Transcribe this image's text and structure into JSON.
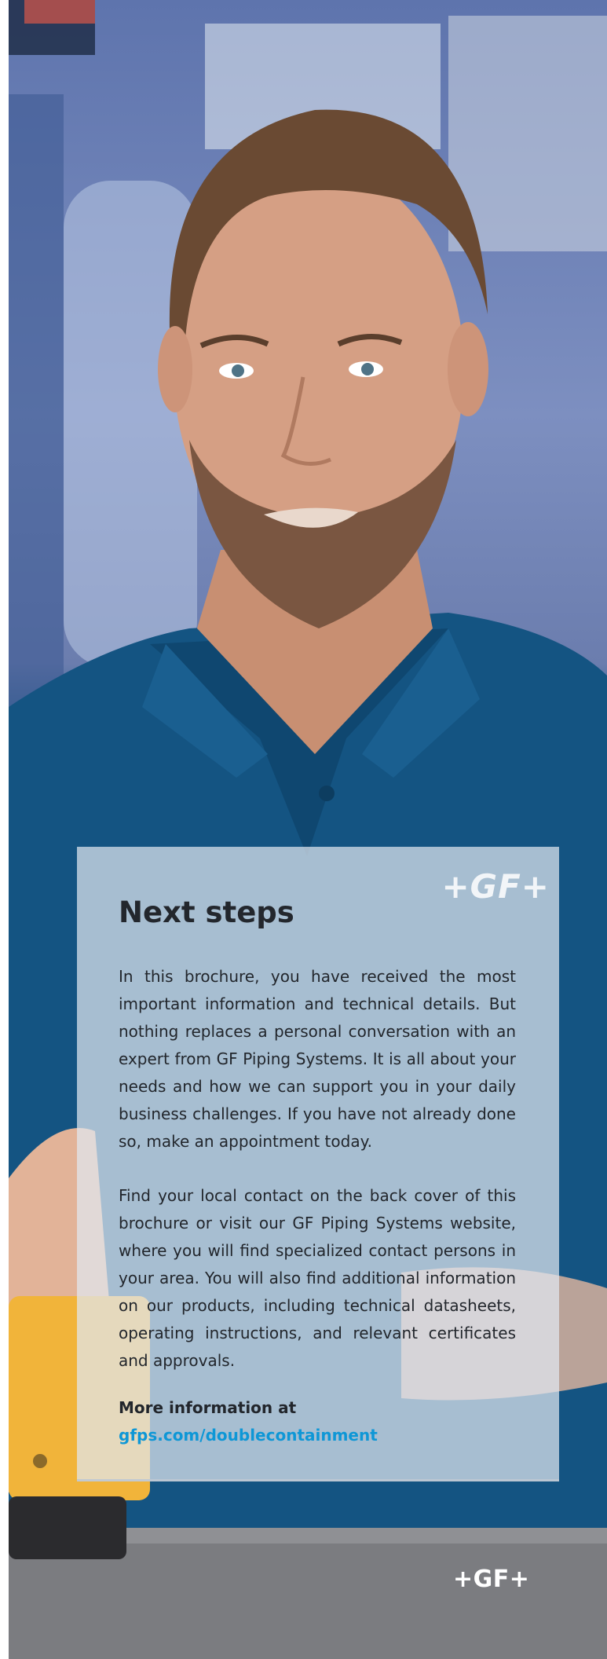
{
  "card": {
    "logo": "+GF+",
    "title": "Next steps",
    "paragraph_1": "In this brochure, you have received the most important information and technical details. But nothing replaces a personal conversation with an expert from GF Piping Systems. It is all about your needs and how we can support you in your daily business challenges. If you have not already done so, make an appointment today.",
    "paragraph_2": "Find your local contact on the back cover of this brochure or visit our GF Piping Systems website, where you will find specialized contact persons in your area. You will also find additional information on our products, including technical datasheets, operating instructions, and relevant certificates and approvals.",
    "more_label": "More information at",
    "more_link": "gfps.com/doublecontainment"
  },
  "footer": {
    "logo": "+GF+"
  },
  "colors": {
    "link": "#0e97d6",
    "text": "#22262c",
    "shirt": "#145482"
  }
}
